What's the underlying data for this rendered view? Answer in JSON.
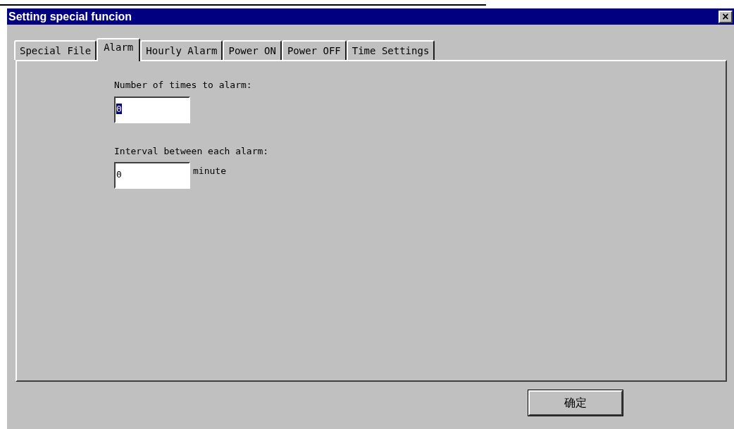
{
  "window": {
    "title": "Setting special funcion",
    "close": "×"
  },
  "tabs": [
    {
      "label": "Special File",
      "selected": false
    },
    {
      "label": "Alarm",
      "selected": true
    },
    {
      "label": "Hourly Alarm",
      "selected": false
    },
    {
      "label": "Power ON",
      "selected": false
    },
    {
      "label": "Power OFF",
      "selected": false
    },
    {
      "label": "Time Settings",
      "selected": false
    }
  ],
  "fields": [
    {
      "label": "Number of times to alarm:",
      "value": "0",
      "highlighted": true
    },
    {
      "label": "Interval between each alarm:",
      "value": "0",
      "highlighted": false,
      "unit": "minute"
    }
  ],
  "buttons": [
    "确定"
  ]
}
